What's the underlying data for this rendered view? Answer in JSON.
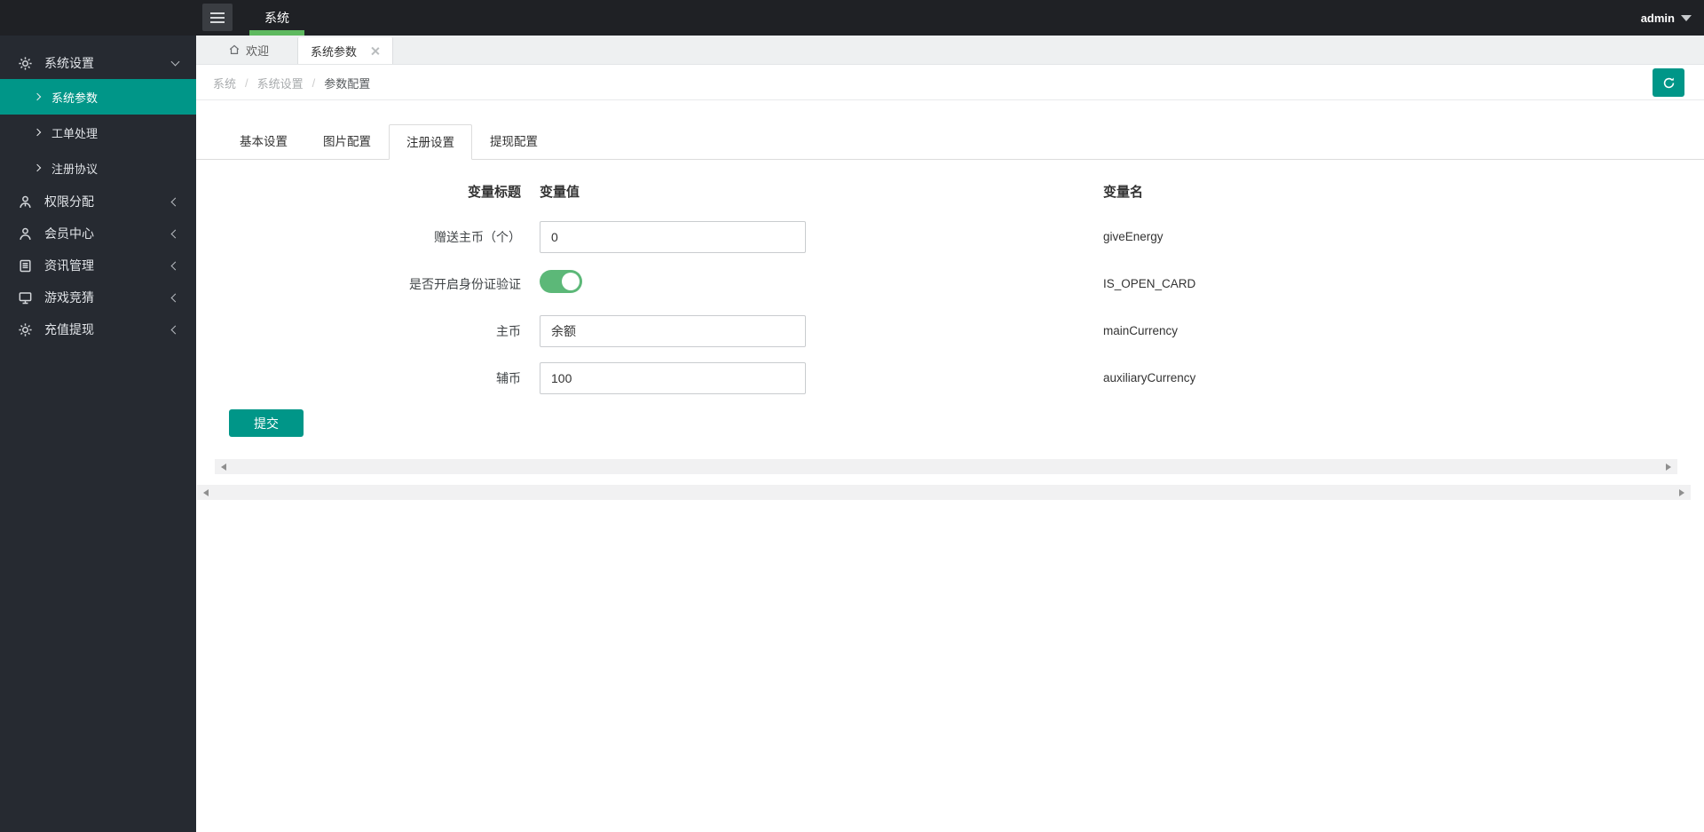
{
  "topbar": {
    "nav_item": "系统",
    "user": "admin"
  },
  "sidebar": {
    "groups": [
      {
        "label": "系统设置",
        "icon": "gear-icon",
        "expanded": true,
        "children": [
          {
            "label": "系统参数",
            "active": true
          },
          {
            "label": "工单处理",
            "active": false
          },
          {
            "label": "注册协议",
            "active": false
          }
        ]
      },
      {
        "label": "权限分配",
        "icon": "user-tie-icon"
      },
      {
        "label": "会员中心",
        "icon": "user-icon"
      },
      {
        "label": "资讯管理",
        "icon": "book-icon"
      },
      {
        "label": "游戏竞猜",
        "icon": "monitor-icon"
      },
      {
        "label": "充值提现",
        "icon": "gear-icon"
      }
    ]
  },
  "tabbar": {
    "home_tab": "欢迎",
    "active_tab": "系统参数"
  },
  "breadcrumb": {
    "items": [
      "系统",
      "系统设置",
      "参数配置"
    ],
    "separator": "/"
  },
  "content_tabs": {
    "tab0": "基本设置",
    "tab1": "图片配置",
    "tab2": "注册设置",
    "tab3": "提现配置",
    "active": "注册设置"
  },
  "form": {
    "headers": {
      "title": "变量标题",
      "value": "变量值",
      "name": "变量名"
    },
    "rows": [
      {
        "label": "赠送主币（个）",
        "type": "input",
        "value": "0",
        "name": "giveEnergy"
      },
      {
        "label": "是否开启身份证验证",
        "type": "switch",
        "checked": true,
        "name": "IS_OPEN_CARD"
      },
      {
        "label": "主币",
        "type": "input",
        "value": "余额",
        "name": "mainCurrency"
      },
      {
        "label": "辅币",
        "type": "input",
        "value": "100",
        "name": "auxiliaryCurrency"
      }
    ],
    "submit_label": "提交"
  },
  "colors": {
    "accent_teal": "#009688",
    "topnav_green": "#5eb95f",
    "switch_green": "#5cb878",
    "topbar_bg": "#1f2125",
    "sidebar_bg": "#262a31"
  }
}
